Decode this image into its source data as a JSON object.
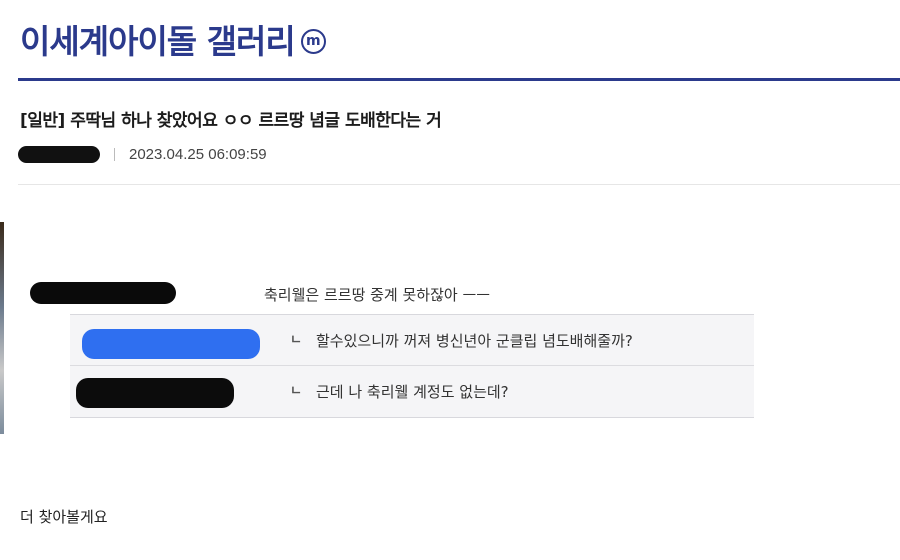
{
  "gallery": {
    "title": "이세계아이돌 갤러리",
    "badge": "m"
  },
  "post": {
    "title": "[일반] 주딱님 하나 찾았어요 ㅇㅇ 르르땅 념글 도배한다는 거",
    "date": "2023.04.25 06:09:59",
    "body": "더 찾아볼게요"
  },
  "comments": {
    "main": "축리웰은 르르땅 중계 못하잖아 ㅡㅡ",
    "replies": [
      {
        "arrow": "ㄴ",
        "text": "할수있으니까 꺼져 병신년아 군클립 념도배해줄까?"
      },
      {
        "arrow": "ㄴ",
        "text": "근데 나 축리웰 계정도 없는데?"
      }
    ]
  },
  "colors": {
    "brand": "#2b3a8c",
    "redaction_blue": "#2f6ff0",
    "redaction_black": "#0a0a0a"
  }
}
